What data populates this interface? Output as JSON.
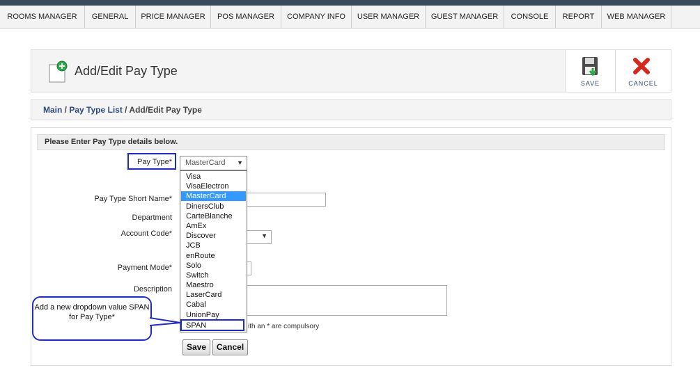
{
  "menu": {
    "items": [
      "ROOMS MANAGER",
      "GENERAL",
      "PRICE MANAGER",
      "POS MANAGER",
      "COMPANY INFO",
      "USER MANAGER",
      "GUEST MANAGER",
      "CONSOLE",
      "REPORT",
      "WEB MANAGER"
    ]
  },
  "header": {
    "title": "Add/Edit Pay Type",
    "save_label": "SAVE",
    "cancel_label": "CANCEL"
  },
  "breadcrumb": {
    "main": "Main",
    "sep1": " / ",
    "list": "Pay Type List",
    "sep2": " / ",
    "current": "Add/Edit Pay Type"
  },
  "form": {
    "instruction": "Please Enter Pay Type details below.",
    "pay_type_label": "Pay Type*",
    "pay_type_value": "MasterCard",
    "short_name_label": "Pay Type Short Name*",
    "department_label": "Department",
    "account_code_label": "Account Code*",
    "payment_mode_label": "Payment Mode*",
    "description_label": "Description",
    "footnote": "ith an * are compulsory",
    "save_button": "Save",
    "cancel_button": "Cancel"
  },
  "dropdown": {
    "options": [
      "Visa",
      "VisaElectron",
      "MasterCard",
      "DinersClub",
      "CarteBlanche",
      "AmEx",
      "Discover",
      "JCB",
      "enRoute",
      "Solo",
      "Switch",
      "Maestro",
      "LaserCard",
      "Cabal",
      "UnionPay",
      "SPAN"
    ],
    "selected": "MasterCard"
  },
  "annotation": {
    "text": "Add a new dropdown value SPAN for Pay Type*"
  },
  "colors": {
    "highlight_blue": "#1f2cbf",
    "selection_blue": "#3399ff",
    "link_blue": "#2d4a7c"
  }
}
